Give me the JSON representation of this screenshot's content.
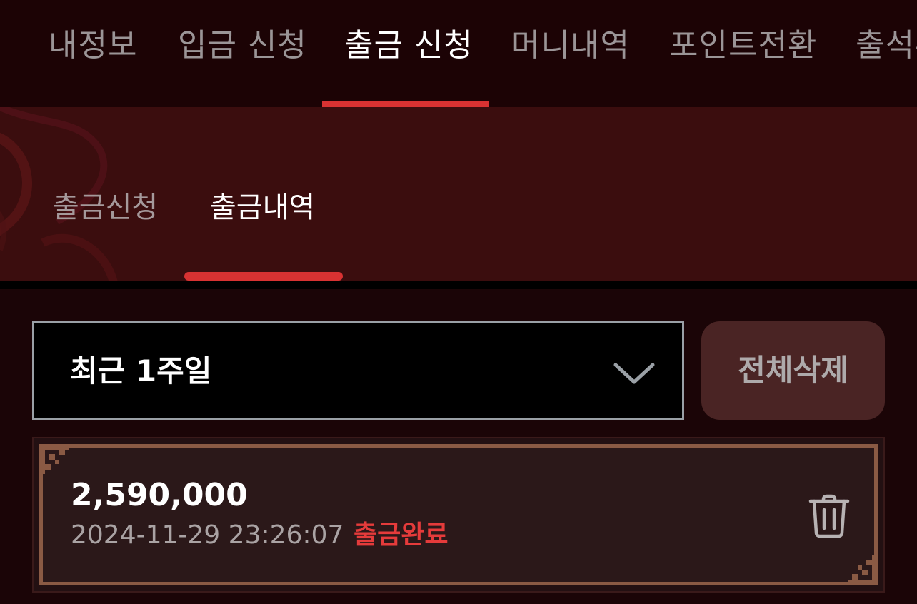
{
  "top_nav": {
    "tabs": [
      {
        "label": "내정보"
      },
      {
        "label": "입금 신청"
      },
      {
        "label": "출금 신청"
      },
      {
        "label": "머니내역"
      },
      {
        "label": "포인트전환"
      },
      {
        "label": "출석부"
      }
    ],
    "active_index": 2
  },
  "sub_nav": {
    "tabs": [
      {
        "label": "출금신청"
      },
      {
        "label": "출금내역"
      }
    ],
    "active_index": 1
  },
  "filter": {
    "selected": "최근 1주일",
    "icon": "chevron-down-icon"
  },
  "delete_all_label": "전체삭제",
  "records": [
    {
      "amount": "2,590,000",
      "datetime": "2024-11-29 23:26:07",
      "status": "출금완료",
      "delete_icon": "trash-icon"
    }
  ],
  "colors": {
    "accent": "#d83232",
    "status_complete": "#e53b3b",
    "background": "#1b0507",
    "subnav_background": "#3b0d0e",
    "card_border": "#8a5a44"
  }
}
